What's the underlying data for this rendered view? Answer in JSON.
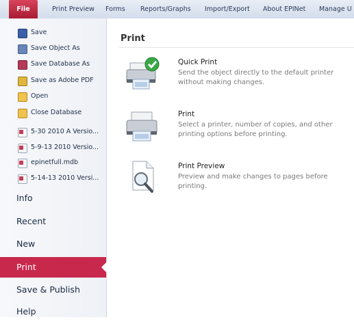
{
  "ribbon": {
    "tabs": [
      "File",
      "Print Preview",
      "Forms",
      "Reports/Graphs",
      "Import/Export",
      "About EPINet",
      "Manage U"
    ]
  },
  "sidebar": {
    "commands": [
      {
        "label": "Save",
        "icon": "save-icon"
      },
      {
        "label": "Save Object As",
        "icon": "save-object-icon"
      },
      {
        "label": "Save Database As",
        "icon": "save-database-icon"
      },
      {
        "label": "Save as Adobe PDF",
        "icon": "pdf-icon"
      },
      {
        "label": "Open",
        "icon": "folder-open-icon"
      },
      {
        "label": "Close Database",
        "icon": "folder-icon"
      }
    ],
    "recent_files": [
      "5-30 2010 A Versio...",
      "5-9-13 2010 Versio...",
      "epinetfull.mdb",
      "5-14-13 2010 Versi..."
    ],
    "sections": [
      "Info",
      "Recent",
      "New",
      "Print",
      "Save & Publish",
      "Help"
    ],
    "active_section": "Print"
  },
  "main": {
    "heading": "Print",
    "options": [
      {
        "title": "Quick Print",
        "description": "Send the object directly to the default printer without making changes.",
        "icon": "quick-print-icon"
      },
      {
        "title": "Print",
        "description": "Select a printer, number of copies, and other printing options before printing.",
        "icon": "printer-icon"
      },
      {
        "title": "Print Preview",
        "description": "Preview and make changes to pages before printing.",
        "icon": "print-preview-icon"
      }
    ]
  },
  "colors": {
    "accent": "#c8284c",
    "file_tab": "#b8243c"
  }
}
